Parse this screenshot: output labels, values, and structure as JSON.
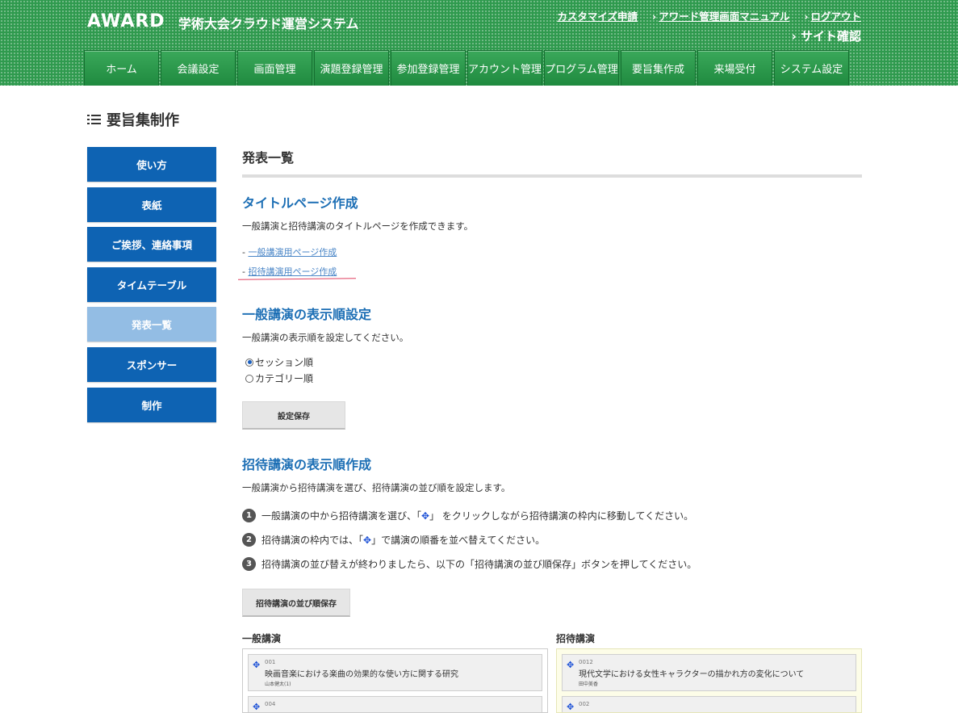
{
  "header": {
    "logo": "AWARD",
    "system_title": "学術大会クラウド運営システム",
    "links": [
      {
        "label": "カスタマイズ申請",
        "arrow": ""
      },
      {
        "label": "アワード管理画面マニュアル",
        "arrow": "›"
      },
      {
        "label": "ログアウト",
        "arrow": "›"
      }
    ],
    "site_check": "サイト確認",
    "site_check_arrow": "›"
  },
  "nav": [
    "ホーム",
    "会議設定",
    "画面管理",
    "演題登録管理",
    "参加登録管理",
    "アカウント管理",
    "プログラム管理",
    "要旨集作成",
    "来場受付",
    "システム設定"
  ],
  "page_title": "要旨集制作",
  "sidebar": [
    "使い方",
    "表紙",
    "ご挨拶、連絡事項",
    "タイムテーブル",
    "発表一覧",
    "スポンサー",
    "制作"
  ],
  "main": {
    "heading": "発表一覧",
    "title_page": {
      "title": "タイトルページ作成",
      "desc": "一般講演と招待講演のタイトルページを作成できます。",
      "link1": "一般講演用ページ作成",
      "link2": "招待講演用ページ作成",
      "dash": "-"
    },
    "order": {
      "title": "一般講演の表示順設定",
      "desc": "一般講演の表示順を設定してください。",
      "option1": "セッション順",
      "option2": "カテゴリー順",
      "save": "設定保存"
    },
    "invited": {
      "title": "招待講演の表示順作成",
      "desc": "一般講演から招待講演を選び、招待講演の並び順を設定します。",
      "steps": [
        {
          "num": "1",
          "pre": "一般講演の中から招待講演を選び、「",
          "post": "」 をクリックしながら招待講演の枠内に移動してください。"
        },
        {
          "num": "2",
          "pre": "招待講演の枠内では、「",
          "post": "」で講演の順番を並べ替えてください。"
        },
        {
          "num": "3",
          "pre": "招待講演の並び替えが終わりましたら、以下の「招待講演の並び順保存」ボタンを押してください。",
          "post": ""
        }
      ],
      "save": "招待講演の並び順保存",
      "move_glyph": "✥",
      "general_label": "一般講演",
      "invited_label": "招待講演",
      "general": [
        {
          "num": "001",
          "title": "映画音楽における楽曲の効果的な使い方に関する研究",
          "author": "山本健太(1)"
        },
        {
          "num": "004",
          "title": "",
          "author": ""
        }
      ],
      "invited_list": [
        {
          "num": "0012",
          "title": "現代文学における女性キャラクターの描かれ方の変化について",
          "author": "田中美香"
        },
        {
          "num": "002",
          "title": "",
          "author": ""
        }
      ]
    }
  }
}
